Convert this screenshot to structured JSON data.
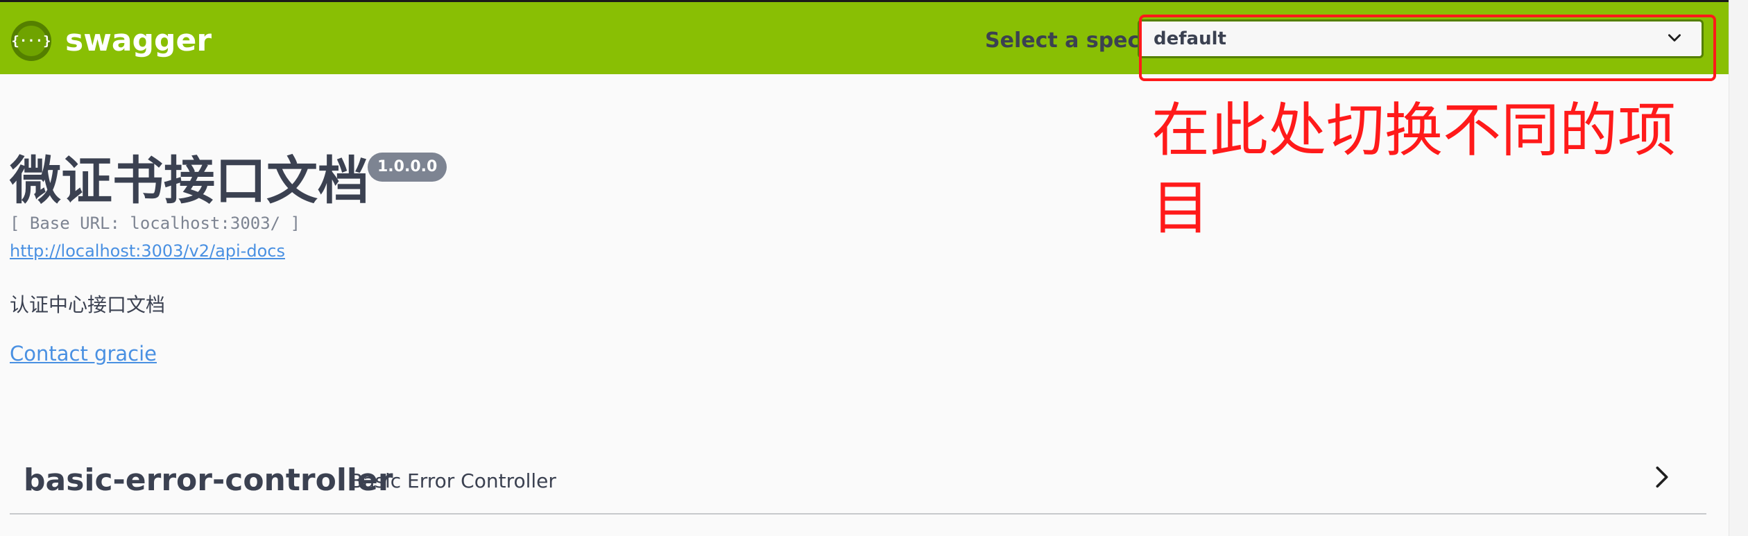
{
  "topbar": {
    "logo_glyph": "{···}",
    "logo_text": "swagger",
    "select_label": "Select a spec",
    "select_value": "default"
  },
  "annotation": {
    "text": "在此处切换不同的项目"
  },
  "info": {
    "title": "微证书接口文档",
    "version": "1.0.0.0",
    "base_url": "[ Base URL: localhost:3003/ ]",
    "api_docs_link": "http://localhost:3003/v2/api-docs",
    "description": "认证中心接口文档",
    "contact": "Contact gracie"
  },
  "tags": [
    {
      "name": "basic-error-controller",
      "description": "Basic Error Controller",
      "icon": "chevron-right-icon"
    }
  ],
  "colors": {
    "topbar": "#89bf04",
    "annotation": "#ff1a1a",
    "link": "#4990e2"
  }
}
